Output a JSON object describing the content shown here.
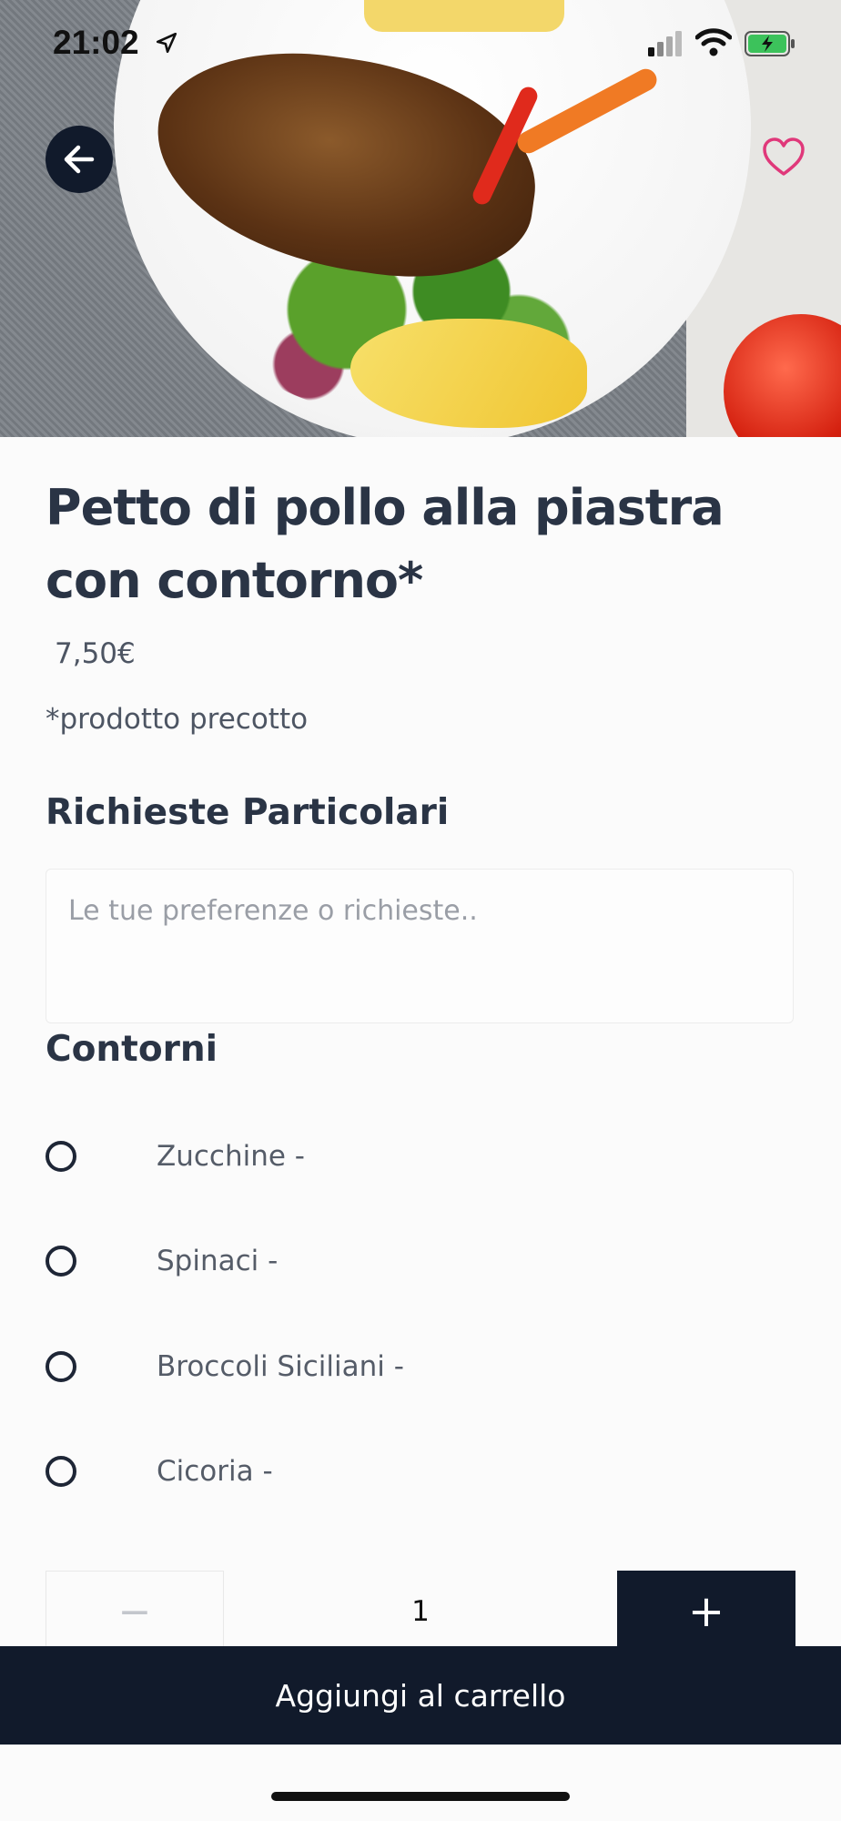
{
  "status_bar": {
    "time": "21:02"
  },
  "hero": {
    "image": "grilled-chicken-breast-with-salad",
    "back_icon": "arrow-left-icon",
    "favorite_icon": "heart-outline-icon",
    "favorite_color": "#e0387a"
  },
  "product": {
    "title": "Petto di pollo alla piastra con contorno*",
    "price": "7,50€",
    "note": "*prodotto precotto"
  },
  "special_requests": {
    "heading": "Richieste Particolari",
    "placeholder": "Le tue preferenze o richieste..",
    "value": ""
  },
  "sides": {
    "heading": "Contorni",
    "options": [
      {
        "label": "Zucchine  -",
        "selected": false
      },
      {
        "label": "Spinaci  -",
        "selected": false
      },
      {
        "label": "Broccoli Siciliani  -",
        "selected": false
      },
      {
        "label": "Cicoria  -",
        "selected": false
      }
    ]
  },
  "quantity": {
    "minus_label": "−",
    "value": "1",
    "plus_label": "+"
  },
  "cart": {
    "button_label": "Aggiungi al carrello"
  },
  "colors": {
    "primary": "#111a2b",
    "text": "#2a3445",
    "accent_heart": "#e0387a"
  }
}
